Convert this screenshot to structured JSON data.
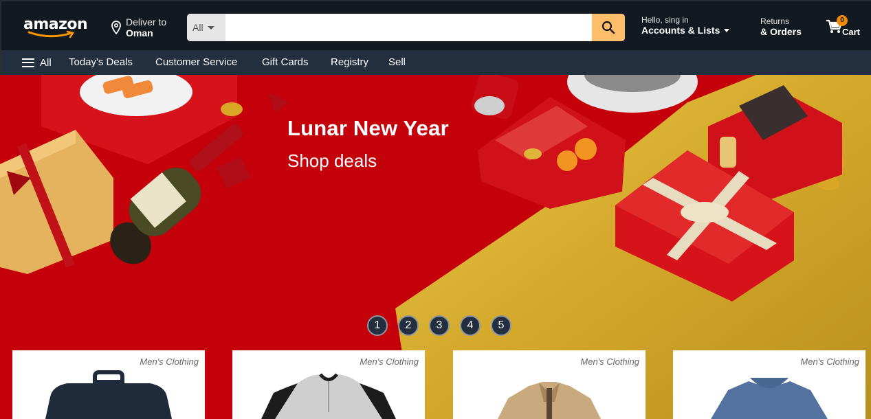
{
  "header": {
    "logo_text": "amazon",
    "deliver_line1": "Deliver to",
    "deliver_line2": "Oman",
    "search": {
      "category": "All",
      "placeholder": "",
      "value": ""
    },
    "account_line1": "Hello, sing in",
    "account_line2": "Accounts & Lists",
    "orders_line1": "Returns",
    "orders_line2": "& Orders",
    "cart_count": "0",
    "cart_label": "Cart"
  },
  "nav": {
    "all_label": "All",
    "items": [
      "Today's Deals",
      "Customer Service",
      "Gift Cards",
      "Registry",
      "Sell"
    ]
  },
  "hero": {
    "title": "Lunar New Year",
    "subtitle": "Shop deals",
    "slides": [
      "1",
      "2",
      "3",
      "4",
      "5"
    ]
  },
  "products": [
    {
      "category": "Men's Clothing",
      "icon": "bag-icon"
    },
    {
      "category": "Men's Clothing",
      "icon": "henley-shirt-icon"
    },
    {
      "category": "Men's Clothing",
      "icon": "jacket-icon"
    },
    {
      "category": "Men's Clothing",
      "icon": "tshirt-icon"
    }
  ],
  "colors": {
    "header_bg": "#131921",
    "nav_bg": "#232f3e",
    "search_button": "#febd69",
    "hero_red": "#c4000a",
    "hero_gold": "#d9b42e",
    "cart_badge": "#f08804"
  }
}
